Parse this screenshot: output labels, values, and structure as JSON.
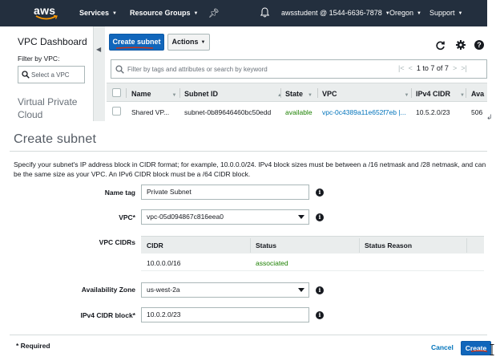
{
  "topnav": {
    "logo": "aws",
    "services": "Services",
    "resource_groups": "Resource Groups",
    "user": "awsstudent @ 1544-6636-7878",
    "region": "Oregon",
    "support": "Support",
    "bg_color": "#232f3e",
    "icons": [
      "pin-icon",
      "bell-icon"
    ]
  },
  "sidebar": {
    "title": "VPC Dashboard",
    "filter_label": "Filter by VPC:",
    "vpc_select_placeholder": "Select a VPC",
    "section": "Virtual Private Cloud"
  },
  "toolbar": {
    "create_subnet": "Create subnet",
    "actions": "Actions",
    "icons": [
      "refresh-icon",
      "gear-icon",
      "help-icon"
    ]
  },
  "search": {
    "placeholder": "Filter by tags and attributes or search by keyword",
    "pager": "1 to 7 of 7"
  },
  "subnet_table": {
    "columns": [
      "Name",
      "Subnet ID",
      "State",
      "VPC",
      "IPv4 CIDR",
      "Ava"
    ],
    "rows": [
      {
        "name": "Shared VP...",
        "subnet_id": "subnet-0b89646460bc50edd",
        "state": "available",
        "vpc": "vpc-0c4389a11e652f7eb |...",
        "cidr": "10.5.2.0/23",
        "available": "506"
      }
    ]
  },
  "form": {
    "title": "Create subnet",
    "description": "Specify your subnet's IP address block in CIDR format; for example, 10.0.0.0/24. IPv4 block sizes must be between a /16 netmask and /28 netmask, and can be the same size as your VPC. An IPv6 CIDR block must be a /64 CIDR block.",
    "name_tag_label": "Name tag",
    "name_tag_value": "Private Subnet",
    "vpc_label": "VPC*",
    "vpc_value": "vpc-05d094867c816eea0",
    "vpc_cidrs_label": "VPC CIDRs",
    "cidr_columns": [
      "CIDR",
      "Status",
      "Status Reason"
    ],
    "cidr_rows": [
      {
        "cidr": "10.0.0.0/16",
        "status": "associated",
        "reason": ""
      }
    ],
    "az_label": "Availability Zone",
    "az_value": "us-west-2a",
    "ipv4_label": "IPv4 CIDR block*",
    "ipv4_value": "10.0.2.0/23",
    "required_note": "* Required",
    "cancel": "Cancel",
    "create": "Create"
  },
  "colors": {
    "primary": "#1166bb",
    "link": "#0073bb",
    "success": "#1d8102",
    "annotation": "#d13212"
  }
}
